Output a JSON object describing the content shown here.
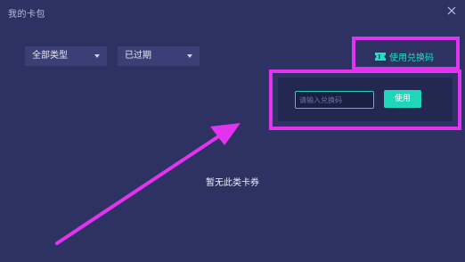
{
  "window": {
    "title": "我的卡包"
  },
  "filters": {
    "type_selected": "全部类型",
    "status_selected": "已过期"
  },
  "redeem": {
    "link_label": "使用兑换码",
    "input_placeholder": "请输入兑换码",
    "input_value": "",
    "use_button_label": "使用"
  },
  "empty_state": {
    "message": "暂无此类卡券"
  },
  "icons": {
    "close": "close-icon",
    "ticket": "ticket-icon",
    "chevron": "chevron-down-icon"
  },
  "colors": {
    "background": "#2e3262",
    "accent": "#1fd6bb",
    "annotation": "#e234f0"
  }
}
